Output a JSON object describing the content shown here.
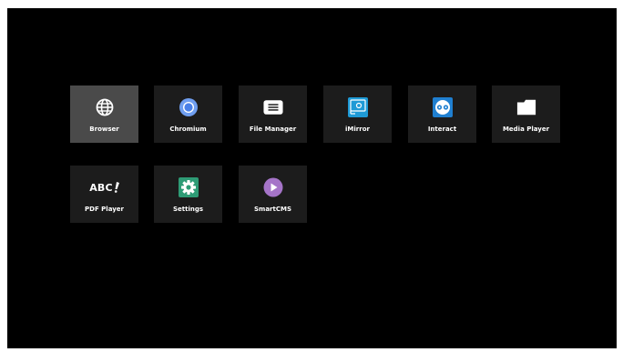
{
  "apps": [
    {
      "label": "Browser",
      "icon": "globe-icon",
      "focused": true
    },
    {
      "label": "Chromium",
      "icon": "chromium-icon"
    },
    {
      "label": "File Manager",
      "icon": "file-manager-icon"
    },
    {
      "label": "iMirror",
      "icon": "imirror-icon"
    },
    {
      "label": "Interact",
      "icon": "interact-icon"
    },
    {
      "label": "Media Player",
      "icon": "folder-icon"
    },
    {
      "label": "PDF Player",
      "icon": "abc-icon",
      "icon_text": "ABC"
    },
    {
      "label": "Settings",
      "icon": "gear-icon"
    },
    {
      "label": "SmartCMS",
      "icon": "play-icon"
    }
  ],
  "colors": {
    "background": "#000000",
    "tile": "#1c1c1c",
    "tile_focused": "#4a4a4a",
    "chromium_blue": "#4a80e8",
    "imirror_blue": "#1e9ad6",
    "interact_blue": "#1f7fd0",
    "settings_green": "#2e9b75",
    "smartcms_purple": "#a574c8"
  }
}
